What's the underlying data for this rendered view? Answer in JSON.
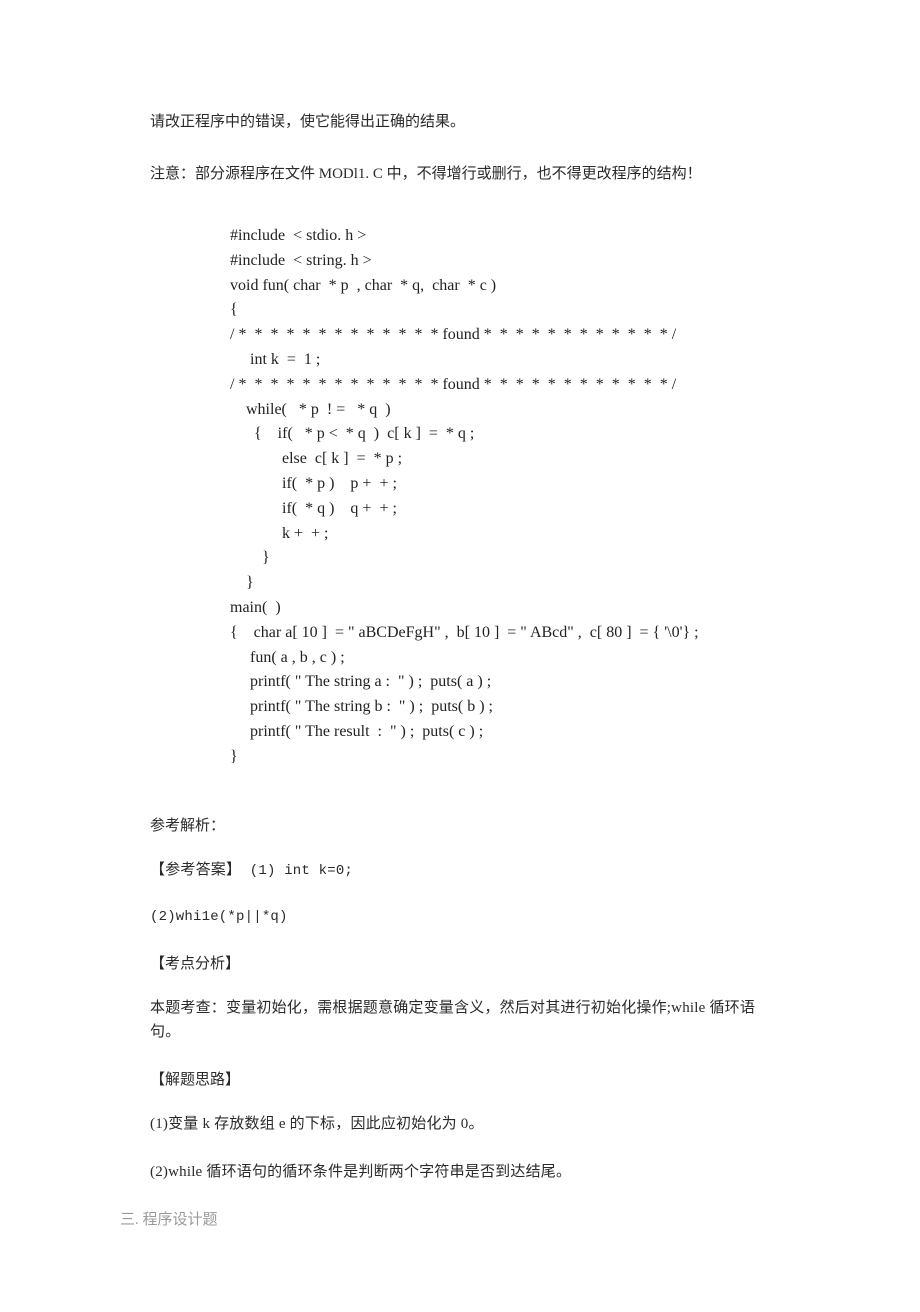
{
  "intro": {
    "p1": "请改正程序中的错误，使它能得出正确的结果。",
    "p2": "注意：部分源程序在文件 MODl1. C 中，不得增行或删行，也不得更改程序的结构！"
  },
  "code": {
    "l01": "#include  < stdio. h >",
    "l02": "#include  < string. h >",
    "l03": "void fun( char  * p  , char  * q,  char  * c )",
    "l04": "{",
    "l05": "/ *  *  *  *  *  *  *  *  *  *  *  *  * found *  *  *  *  *  *  *  *  *  *  *  * /",
    "l06": "     int k  =  1 ;",
    "l07": "/ *  *  *  *  *  *  *  *  *  *  *  *  * found *  *  *  *  *  *  *  *  *  *  *  * /",
    "l08": "    while(   * p  ! =   * q  )",
    "l09": "      {    if(   * p <  * q  )  c[ k ]  =  * q ;",
    "l10": "",
    "l11": "             else  c[ k ]  =  * p ;",
    "l12": "             if(  * p )    p +  + ;",
    "l13": "             if(  * q )    q +  + ;",
    "l14": "             k +  + ;",
    "l15": "        }",
    "l16": "    }",
    "l17": "",
    "l18": "",
    "l19": "main(  )",
    "l20": "{    char a[ 10 ]  = \" aBCDeFgH\" ,  b[ 10 ]  = \" ABcd\" ,  c[ 80 ]  = { '\\0'} ;",
    "l21": "     fun( a , b , c ) ;",
    "l22": "     printf( \" The string a :  \" ) ;  puts( a ) ;",
    "l23": "     printf( \" The string b :  \" ) ;  puts( b ) ;",
    "l24": "     printf( \" The result  :  \" ) ;  puts( c ) ;",
    "l25": "}"
  },
  "analysis": {
    "heading1": "参考解析：",
    "ans1_label": "【参考答案】",
    "ans1_text": "  (1) int k=0;",
    "ans2": "(2)whi1e(*p||*q)",
    "heading2": "【考点分析】",
    "exp1": "本题考查：变量初始化，需根据题意确定变量含义，然后对其进行初始化操作;while 循环语句。",
    "heading3": "【解题思路】",
    "exp2": "(1)变量 k 存放数组 e 的下标，因此应初始化为 0。",
    "exp3": "(2)while 循环语句的循环条件是判断两个字符串是否到达结尾。"
  },
  "footer": {
    "section": "三.  程序设计题"
  }
}
